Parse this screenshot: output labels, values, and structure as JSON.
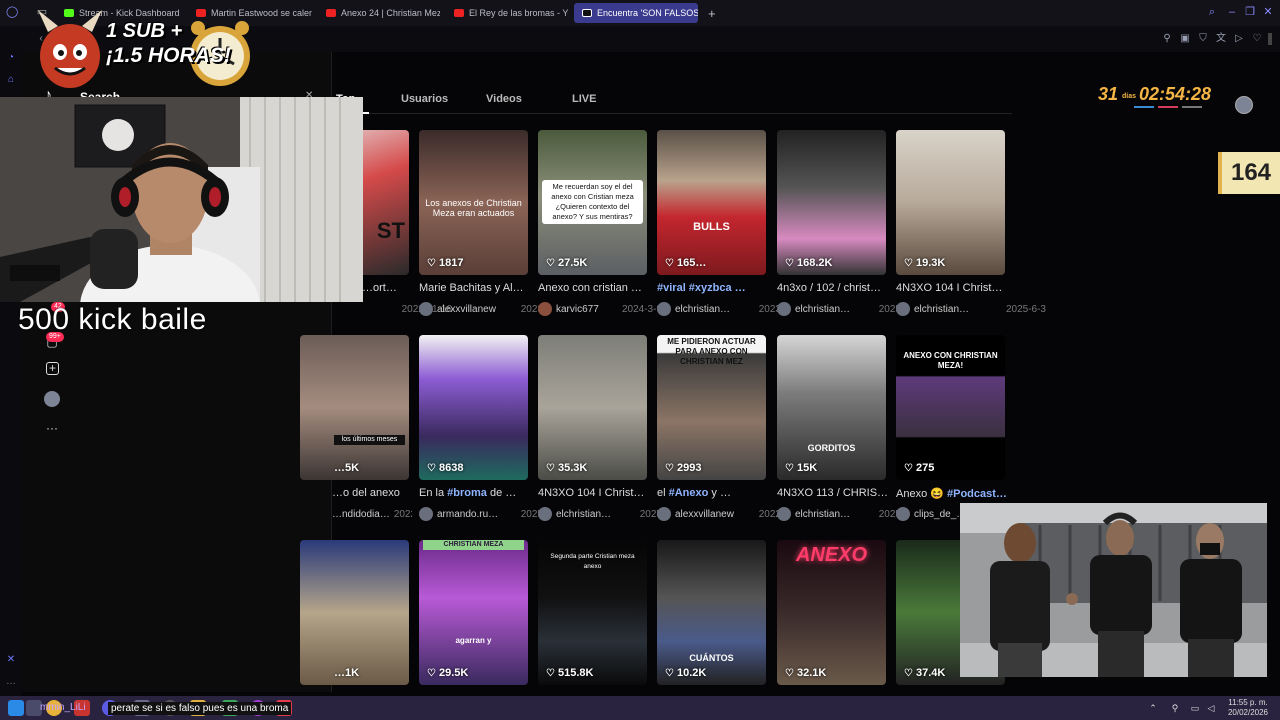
{
  "browser": {
    "tabs": [
      {
        "label": "Stream - Kick Dashboard",
        "active": false
      },
      {
        "label": "Martin Eastwood se calent",
        "active": false
      },
      {
        "label": "Anexo 24 | Christian Mez",
        "active": false
      },
      {
        "label": "El Rey de las bromas - You",
        "active": false
      },
      {
        "label": "Encuentra 'SON FALSOS L",
        "active": true
      }
    ],
    "new_tab_label": "+"
  },
  "tiktok": {
    "search_label": "Search",
    "tabs": [
      {
        "label": "Top",
        "active": true
      },
      {
        "label": "Usuarios",
        "active": false
      },
      {
        "label": "Videos",
        "active": false
      },
      {
        "label": "LIVE",
        "active": false
      }
    ],
    "side_badges": {
      "inbox": "42",
      "activity": "99+"
    },
    "videos": [
      {
        "likes": "",
        "caption_text": "…ort…",
        "caption_tag": "",
        "author": "",
        "date": "2022-11-16"
      },
      {
        "likes": "1817",
        "caption_text": "Marie Bachitas y Al…",
        "caption_tag": "",
        "author": "alexxvillanew",
        "date": "2023"
      },
      {
        "likes": "27.5K",
        "caption_text": "Anexo con cristian …",
        "caption_tag": "",
        "author": "karvic677",
        "date": "2024-3-9"
      },
      {
        "likes": "165…",
        "caption_text": "",
        "caption_tag": "#viral #xyzbca …",
        "author": "elchristian…",
        "date": "2023"
      },
      {
        "likes": "168.2K",
        "caption_text": "4n3xo / 102 / christ…",
        "caption_tag": "",
        "author": "elchristian…",
        "date": "2025"
      },
      {
        "likes": "19.3K",
        "caption_text": "4N3XO 104 I Christ…",
        "caption_tag": "",
        "author": "elchristian…",
        "date": "2025-6-3"
      },
      {
        "likes": "…5K",
        "caption_text": "…o del anexo",
        "caption_tag": "",
        "author": "…ndidodia…",
        "date": "2022"
      },
      {
        "likes": "8638",
        "caption_text": "En la ",
        "caption_tag": "#broma",
        "caption_after": " de …",
        "author": "armando.ru…",
        "date": "2025"
      },
      {
        "likes": "35.3K",
        "caption_text": "4N3XO 104 I Christ…",
        "caption_tag": "",
        "author": "elchristian…",
        "date": "2025"
      },
      {
        "likes": "2993",
        "caption_text": "el ",
        "caption_tag": "#Anexo",
        "caption_after": " y …",
        "author": "alexxvillanew",
        "date": "2022"
      },
      {
        "likes": "15K",
        "caption_text": "4N3XO 113 / CHRIS…",
        "caption_tag": "",
        "author": "elchristian…",
        "date": "2025"
      },
      {
        "likes": "275",
        "caption_text": "Anexo 😆 ",
        "caption_tag": "#Podcast…",
        "author": "clips_de_…",
        "date": ""
      },
      {
        "likes": "…1K",
        "caption_text": "",
        "caption_tag": "",
        "author": "",
        "date": ""
      },
      {
        "likes": "29.5K",
        "caption_text": "",
        "caption_tag": "",
        "author": "",
        "date": ""
      },
      {
        "likes": "515.8K",
        "caption_text": "",
        "caption_tag": "",
        "author": "",
        "date": ""
      },
      {
        "likes": "10.2K",
        "caption_text": "",
        "caption_tag": "",
        "author": "",
        "date": ""
      },
      {
        "likes": "32.1K",
        "caption_text": "",
        "caption_tag": "",
        "author": "",
        "date": ""
      },
      {
        "likes": "37.4K",
        "caption_text": "",
        "caption_tag": "",
        "author": "",
        "date": ""
      }
    ],
    "thumb_texts": {
      "lost": "ST",
      "anexos": "Los anexos de Christian Meza eran actuados",
      "recuerdan": "Me recuerdan soy el del anexo con Cristian meza ¿Quieren contexto del anexo? Y sus mentiras?",
      "pidieron": "ME PIDIERON ACTUAR PARA ANEXO CON CHRISTIAN MEZ",
      "gorditos": "GORDITOS",
      "anexo_meza": "ANEXO CON CHRISTIAN MEZA!",
      "ultimos": "los últimos meses",
      "christian_meza": "CHRISTIAN MEZA",
      "agarran": "agarran y",
      "segunda": "Segunda parte Cristian meza anexo",
      "cuantos": "CUÁNTOS",
      "anexo_neon": "ANEXO",
      "bulls": "BULLS"
    }
  },
  "stream_overlay": {
    "sub_goal_line1": "1 SUB +",
    "sub_goal_line2": "¡1.5 HORAS!",
    "webcam_caption": "500 kick baile",
    "timer_days": "31",
    "timer_days_label": "días",
    "timer_time": "02:54:28",
    "counter": "164",
    "ticker_user": "mmin_LiLi",
    "ticker_message": "perate se si es falso pues es una broma"
  },
  "taskbar": {
    "time": "11:55 p. m.",
    "date": "20/02/2026"
  },
  "colors": {
    "accent": "#3a3a8e",
    "tiktok_red": "#fe2c55",
    "timer_orange": "#f5b544",
    "counter_bg": "#f2e6b3"
  }
}
